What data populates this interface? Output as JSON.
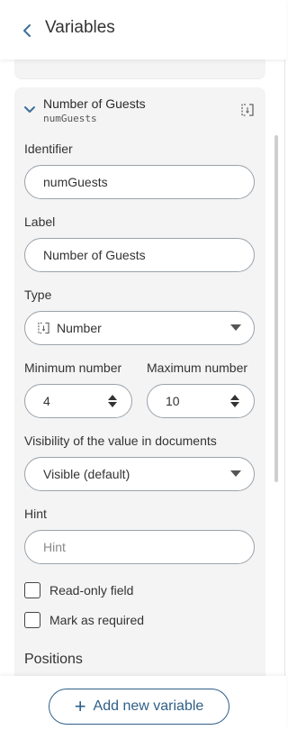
{
  "header": {
    "title": "Variables"
  },
  "variable": {
    "title": "Number of Guests",
    "identifier_code": "numGuests",
    "identifier_label": "Identifier",
    "identifier_value": "numGuests",
    "label_label": "Label",
    "label_value": "Number of Guests",
    "type_label": "Type",
    "type_value": "Number",
    "min_label": "Minimum number",
    "min_value": "4",
    "max_label": "Maximum number",
    "max_value": "10",
    "visibility_label": "Visibility of the value in documents",
    "visibility_value": "Visible (default)",
    "hint_label": "Hint",
    "hint_placeholder": "Hint",
    "readonly_label": "Read-only field",
    "required_label": "Mark as required",
    "positions_title": "Positions"
  },
  "footer": {
    "add_label": "Add new variable"
  },
  "colors": {
    "accent": "#2f5f88",
    "card_bg": "#f4f4f4",
    "border": "#9aa3ab"
  }
}
